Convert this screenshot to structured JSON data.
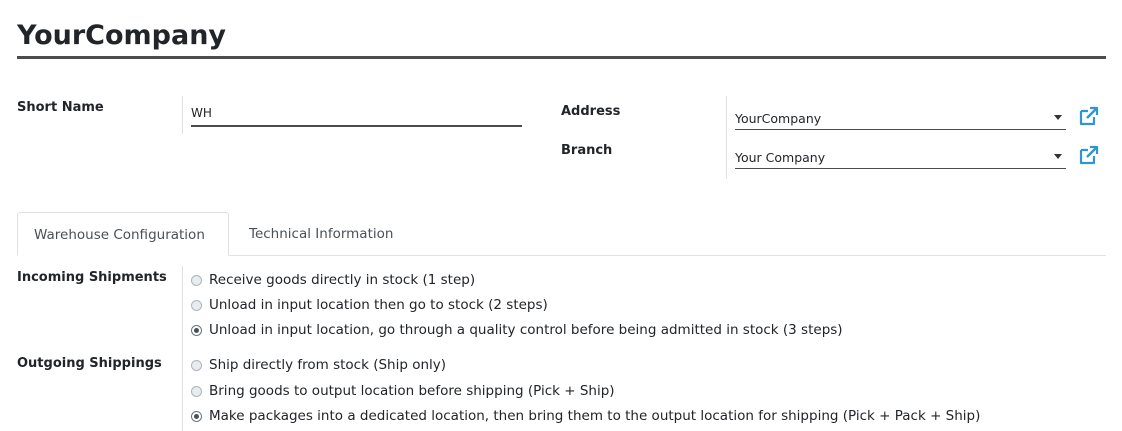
{
  "form": {
    "name": "YourCompany",
    "short_name_label": "Short Name",
    "short_name_value": "WH",
    "address_label": "Address",
    "address_value": "YourCompany",
    "branch_label": "Branch",
    "branch_value": "Your Company"
  },
  "tabs": [
    {
      "label": "Warehouse Configuration",
      "active": true
    },
    {
      "label": "Technical Information",
      "active": false
    }
  ],
  "incoming": {
    "label": "Incoming Shipments",
    "options": [
      {
        "label": "Receive goods directly in stock (1 step)",
        "checked": false
      },
      {
        "label": "Unload in input location then go to stock (2 steps)",
        "checked": false
      },
      {
        "label": "Unload in input location, go through a quality control before being admitted in stock (3 steps)",
        "checked": true
      }
    ]
  },
  "outgoing": {
    "label": "Outgoing Shippings",
    "options": [
      {
        "label": "Ship directly from stock (Ship only)",
        "checked": false
      },
      {
        "label": "Bring goods to output location before shipping (Pick + Ship)",
        "checked": false
      },
      {
        "label": "Make packages into a dedicated location, then bring them to the output location for shipping (Pick + Pack + Ship)",
        "checked": true
      }
    ]
  },
  "colors": {
    "link_icon": "#2e96d3",
    "underline": "#4c4c4c"
  },
  "icons": {
    "external_link": "external-link-icon",
    "dropdown": "chevron-down-icon"
  }
}
